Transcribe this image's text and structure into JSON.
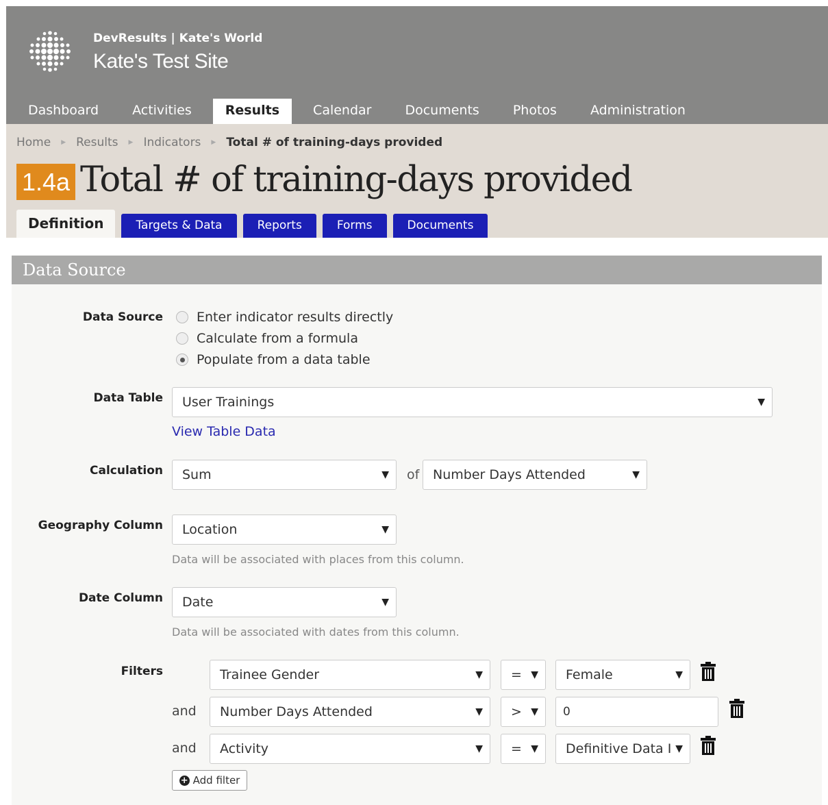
{
  "header": {
    "org": "DevResults | Kate's World",
    "site_title": "Kate's Test Site",
    "logo_icon": "globe-dots-icon"
  },
  "nav": {
    "items": [
      "Dashboard",
      "Activities",
      "Results",
      "Calendar",
      "Documents",
      "Photos",
      "Administration"
    ],
    "active": "Results"
  },
  "breadcrumb": [
    "Home",
    "Results",
    "Indicators",
    "Total # of training-days provided"
  ],
  "indicator": {
    "code": "1.4a",
    "title": "Total # of training-days provided",
    "badge_color": "#e08a1d"
  },
  "tabs": [
    "Definition",
    "Targets & Data",
    "Reports",
    "Forms",
    "Documents"
  ],
  "colors": {
    "tab_blue": "#1b1fb5",
    "header_gray": "#878786",
    "link": "#2a2ab0"
  },
  "panel": {
    "heading": "Data Source",
    "data_source": {
      "label": "Data Source",
      "options": [
        "Enter indicator results directly",
        "Calculate from a formula",
        "Populate from a data table"
      ],
      "selected": "Populate from a data table"
    },
    "data_table": {
      "label": "Data Table",
      "value": "User Trainings",
      "link": "View Table Data"
    },
    "calculation": {
      "label": "Calculation",
      "function": "Sum",
      "of": "of",
      "column": "Number Days Attended"
    },
    "geography": {
      "label": "Geography Column",
      "value": "Location",
      "help": "Data will be associated with places from this column."
    },
    "date": {
      "label": "Date Column",
      "value": "Date",
      "help": "Data will be associated with dates from this column."
    },
    "filters": {
      "label": "Filters",
      "rows": [
        {
          "conj": "",
          "field": "Trainee Gender",
          "op": "=",
          "value": "Female"
        },
        {
          "conj": "and",
          "field": "Number Days Attended",
          "op": ">",
          "value": "0"
        },
        {
          "conj": "and",
          "field": "Activity",
          "op": "=",
          "value": "Definitive Data I"
        }
      ],
      "add_label": "Add filter"
    }
  }
}
